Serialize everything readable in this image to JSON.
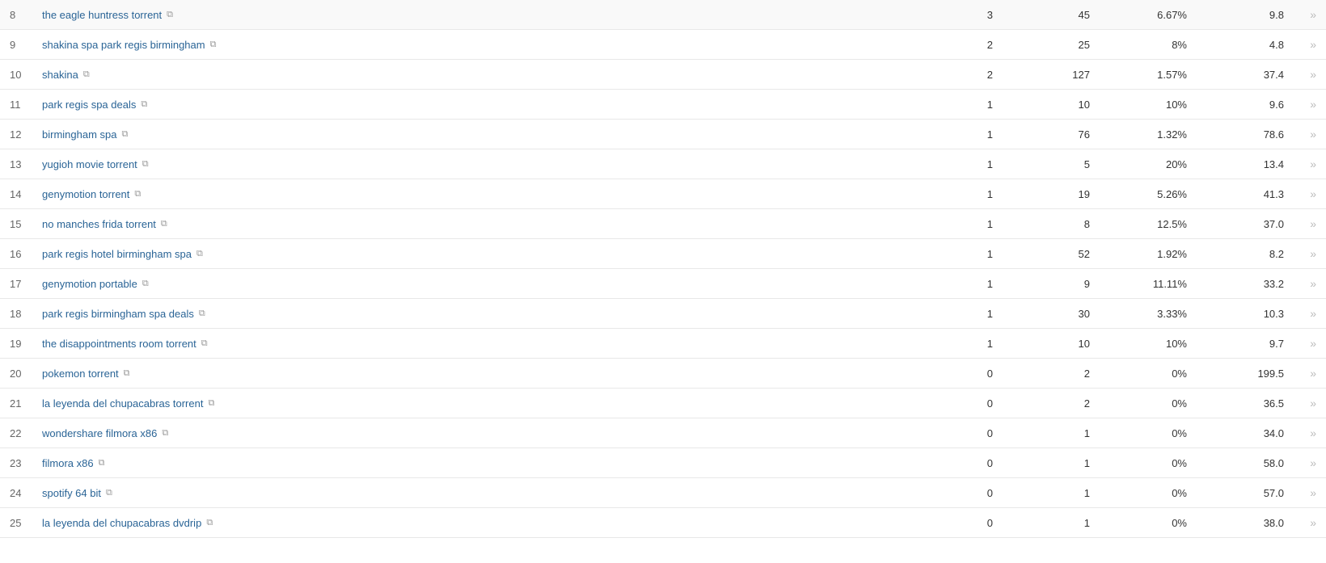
{
  "rows": [
    {
      "num": 8,
      "keyword": "the eagle huntress torrent",
      "clicks": 3,
      "impressions": 45,
      "ctr": "6.67%",
      "position": "9.8"
    },
    {
      "num": 9,
      "keyword": "shakina spa park regis birmingham",
      "clicks": 2,
      "impressions": 25,
      "ctr": "8%",
      "position": "4.8"
    },
    {
      "num": 10,
      "keyword": "shakina",
      "clicks": 2,
      "impressions": 127,
      "ctr": "1.57%",
      "position": "37.4"
    },
    {
      "num": 11,
      "keyword": "park regis spa deals",
      "clicks": 1,
      "impressions": 10,
      "ctr": "10%",
      "position": "9.6"
    },
    {
      "num": 12,
      "keyword": "birmingham spa",
      "clicks": 1,
      "impressions": 76,
      "ctr": "1.32%",
      "position": "78.6"
    },
    {
      "num": 13,
      "keyword": "yugioh movie torrent",
      "clicks": 1,
      "impressions": 5,
      "ctr": "20%",
      "position": "13.4"
    },
    {
      "num": 14,
      "keyword": "genymotion torrent",
      "clicks": 1,
      "impressions": 19,
      "ctr": "5.26%",
      "position": "41.3"
    },
    {
      "num": 15,
      "keyword": "no manches frida torrent",
      "clicks": 1,
      "impressions": 8,
      "ctr": "12.5%",
      "position": "37.0"
    },
    {
      "num": 16,
      "keyword": "park regis hotel birmingham spa",
      "clicks": 1,
      "impressions": 52,
      "ctr": "1.92%",
      "position": "8.2"
    },
    {
      "num": 17,
      "keyword": "genymotion portable",
      "clicks": 1,
      "impressions": 9,
      "ctr": "11.11%",
      "position": "33.2"
    },
    {
      "num": 18,
      "keyword": "park regis birmingham spa deals",
      "clicks": 1,
      "impressions": 30,
      "ctr": "3.33%",
      "position": "10.3"
    },
    {
      "num": 19,
      "keyword": "the disappointments room torrent",
      "clicks": 1,
      "impressions": 10,
      "ctr": "10%",
      "position": "9.7"
    },
    {
      "num": 20,
      "keyword": "pokemon torrent",
      "clicks": 0,
      "impressions": 2,
      "ctr": "0%",
      "position": "199.5"
    },
    {
      "num": 21,
      "keyword": "la leyenda del chupacabras torrent",
      "clicks": 0,
      "impressions": 2,
      "ctr": "0%",
      "position": "36.5"
    },
    {
      "num": 22,
      "keyword": "wondershare filmora x86",
      "clicks": 0,
      "impressions": 1,
      "ctr": "0%",
      "position": "34.0"
    },
    {
      "num": 23,
      "keyword": "filmora x86",
      "clicks": 0,
      "impressions": 1,
      "ctr": "0%",
      "position": "58.0"
    },
    {
      "num": 24,
      "keyword": "spotify 64 bit",
      "clicks": 0,
      "impressions": 1,
      "ctr": "0%",
      "position": "57.0"
    },
    {
      "num": 25,
      "keyword": "la leyenda del chupacabras dvdrip",
      "clicks": 0,
      "impressions": 1,
      "ctr": "0%",
      "position": "38.0"
    }
  ],
  "ext_link_char": "⧉",
  "chevron_char": "»"
}
